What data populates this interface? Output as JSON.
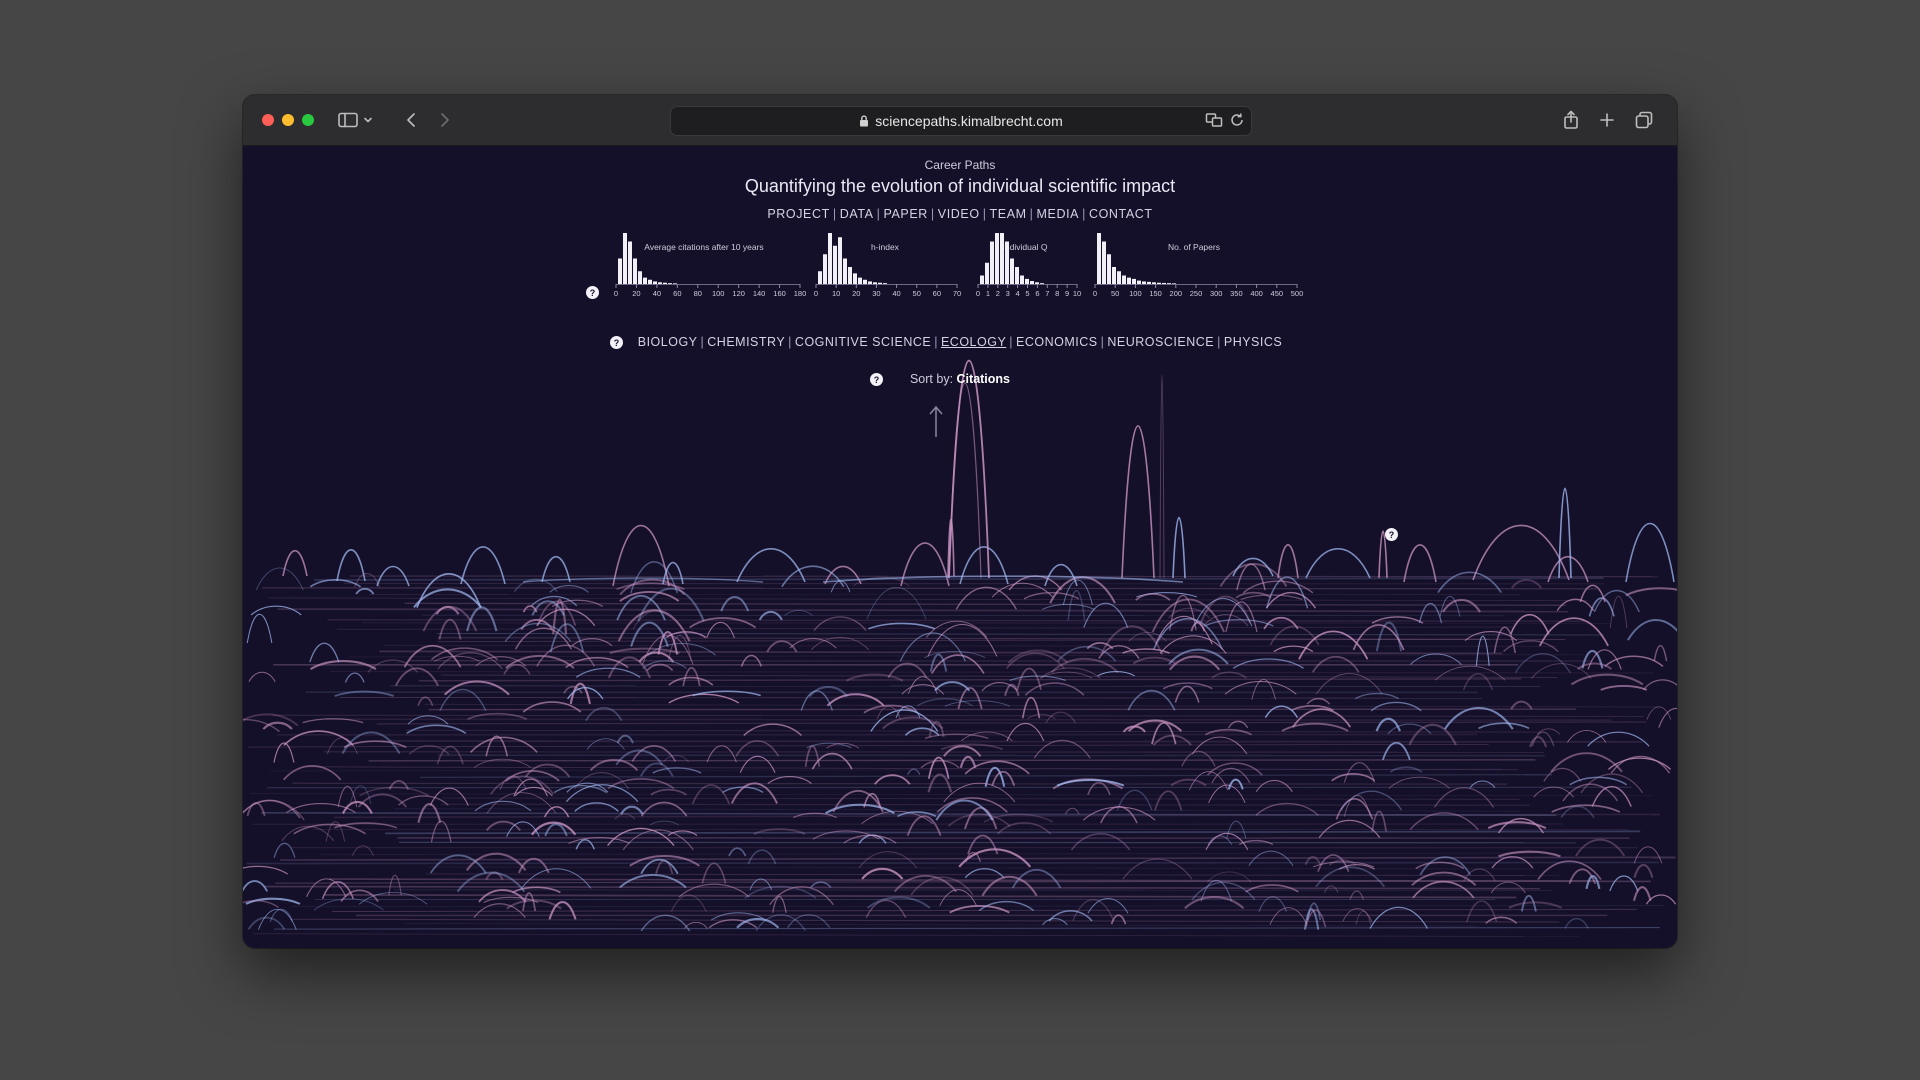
{
  "browser": {
    "url": "sciencepaths.kimalbrecht.com"
  },
  "page": {
    "kicker": "Career Paths",
    "title": "Quantifying the evolution of individual scientific impact",
    "nav": [
      "PROJECT",
      "DATA",
      "PAPER",
      "VIDEO",
      "TEAM",
      "MEDIA",
      "CONTACT"
    ],
    "help_glyph": "?",
    "fields": [
      "BIOLOGY",
      "CHEMISTRY",
      "COGNITIVE SCIENCE",
      "ECOLOGY",
      "ECONOMICS",
      "NEUROSCIENCE",
      "PHYSICS"
    ],
    "active_field": "ECOLOGY",
    "sort_label": "Sort by:",
    "sort_value": "Citations",
    "up_arrow": "↑"
  },
  "colors": {
    "background": "#15102a",
    "arc_pink": "#c994c2",
    "arc_blue": "#9fb8f0",
    "bar": "#f2f0f6"
  },
  "chart_data": [
    {
      "type": "bar",
      "title": "Average citations after 10 years",
      "ticks": [
        0,
        20,
        40,
        60,
        80,
        100,
        120,
        140,
        160,
        180
      ],
      "xlim": [
        0,
        180
      ],
      "values": [
        6,
        12,
        10,
        6,
        3,
        1.5,
        1,
        0.6,
        0.4,
        0.3,
        0.2,
        0.15
      ]
    },
    {
      "type": "bar",
      "title": "h-index",
      "ticks": [
        0,
        10,
        20,
        30,
        40,
        50,
        60,
        70
      ],
      "xlim": [
        0,
        70
      ],
      "values": [
        3,
        7,
        12,
        9,
        11,
        6,
        4,
        2.5,
        1.5,
        1,
        0.6,
        0.4,
        0.3,
        0.2
      ]
    },
    {
      "type": "bar",
      "title": "Individual Q",
      "ticks": [
        0,
        1,
        2,
        3,
        4,
        5,
        6,
        7,
        8,
        9,
        10
      ],
      "xlim": [
        0,
        10
      ],
      "values": [
        2,
        5,
        10,
        12,
        12,
        10,
        6,
        4,
        2,
        1.2,
        0.7,
        0.4,
        0.2
      ]
    },
    {
      "type": "bar",
      "title": "No. of Papers",
      "ticks": [
        0,
        50,
        100,
        150,
        200,
        250,
        300,
        350,
        400,
        450,
        500
      ],
      "xlim": [
        0,
        500
      ],
      "values": [
        12,
        10,
        7,
        4,
        3,
        2,
        1.5,
        1.2,
        0.8,
        0.6,
        0.5,
        0.4,
        0.3,
        0.25,
        0.2,
        0.15
      ]
    }
  ]
}
